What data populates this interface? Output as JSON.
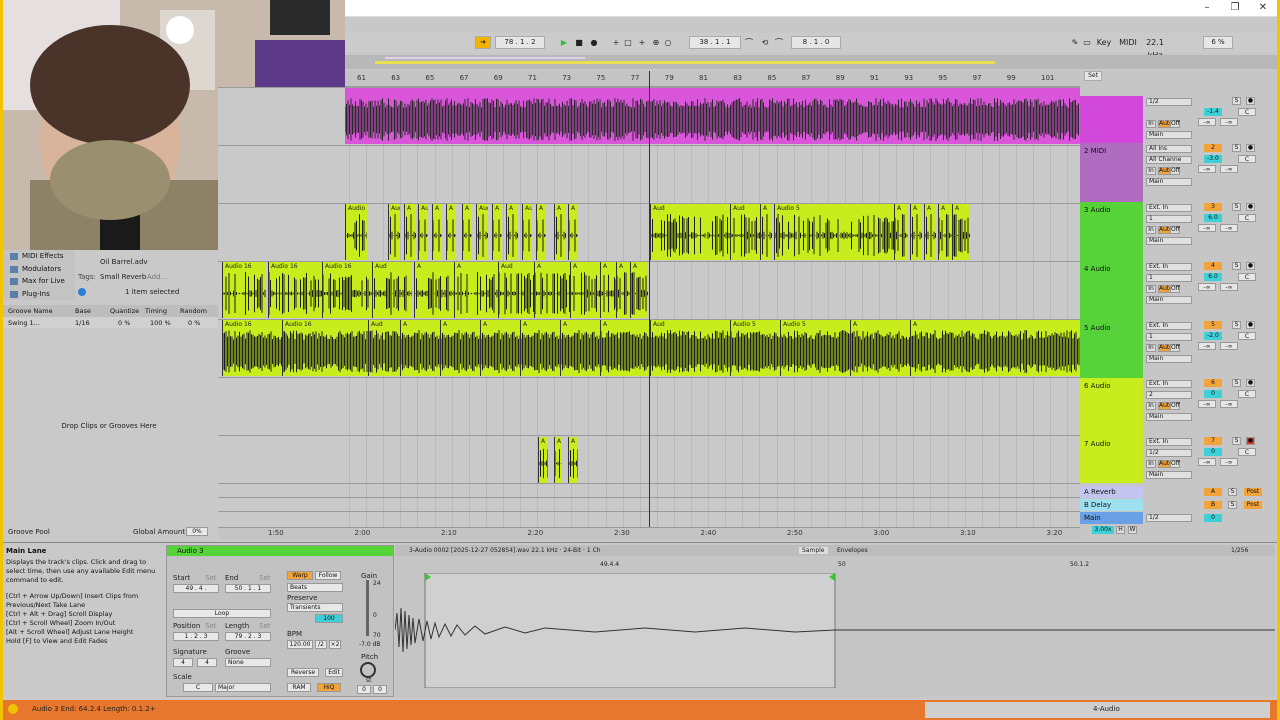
{
  "window": {
    "min": "–",
    "restore": "❐",
    "close": "✕"
  },
  "transport": {
    "follow_icon": "follow-icon",
    "position": "78 .  1 .  2",
    "loop_start": "38 .  1 .  1",
    "loop_length": "8 .  1 .  0",
    "key_label": "Key",
    "midi_label": "MIDI",
    "sample_rate": "22.1 kHz",
    "cpu": "6 %"
  },
  "ruler": {
    "bars": [
      "61",
      "63",
      "65",
      "67",
      "69",
      "71",
      "73",
      "75",
      "77",
      "79",
      "81",
      "83",
      "85",
      "87",
      "89",
      "91",
      "93",
      "95",
      "97",
      "99",
      "101"
    ],
    "times": [
      "1:50",
      "2:00",
      "2:10",
      "2:20",
      "2:30",
      "2:40",
      "2:50",
      "3:00",
      "3:10",
      "3:20"
    ],
    "set_label": "Set"
  },
  "tracks": [
    {
      "name": "",
      "color": "#d147d9",
      "input": "1/2",
      "input2": "",
      "monitor": [
        "In",
        "Auto",
        "Off"
      ],
      "out": "Main",
      "vol": "-1.4",
      "pan": "C",
      "send": "-∞"
    },
    {
      "name": "2 MIDI",
      "color": "#b06cc0",
      "input": "All Ins",
      "input2": "All Channe",
      "monitor": [
        "In",
        "Auto",
        "Off"
      ],
      "out": "Main",
      "vol": "-3.0",
      "pan": "C",
      "num": "2",
      "send": "-∞"
    },
    {
      "name": "3 Audio",
      "color": "#57d33a",
      "input": "Ext. In",
      "input2": "1",
      "monitor": [
        "In",
        "Auto",
        "Off"
      ],
      "out": "Main",
      "vol": "6.0",
      "pan": "C",
      "num": "3",
      "send": "-∞"
    },
    {
      "name": "4 Audio",
      "color": "#57d33a",
      "input": "Ext. In",
      "input2": "1",
      "monitor": [
        "In",
        "Auto",
        "Off"
      ],
      "out": "Main",
      "vol": "6.0",
      "pan": "C",
      "num": "4",
      "send": "-∞"
    },
    {
      "name": "5 Audio",
      "color": "#57d33a",
      "input": "Ext. In",
      "input2": "1",
      "monitor": [
        "In",
        "Auto",
        "Off"
      ],
      "out": "Main",
      "vol": "-2.0",
      "pan": "C",
      "num": "5",
      "send": "-∞"
    },
    {
      "name": "6 Audio",
      "color": "#c8ec1c",
      "input": "Ext. In",
      "input2": "2",
      "monitor": [
        "In",
        "Auto",
        "Off"
      ],
      "out": "Main",
      "vol": "0",
      "pan": "C",
      "num": "6",
      "send": "-∞"
    },
    {
      "name": "7 Audio",
      "color": "#c8ec1c",
      "input": "Ext. In",
      "input2": "1/2",
      "monitor": [
        "In",
        "Auto",
        "Off"
      ],
      "out": "Main",
      "vol": "0",
      "pan": "C",
      "num": "7",
      "send": "-∞"
    }
  ],
  "returns": [
    {
      "name": "A Reverb",
      "num": "A",
      "post": "Post"
    },
    {
      "name": "B Delay",
      "num": "B",
      "post": "Post"
    }
  ],
  "main": {
    "name": "Main",
    "out": "1/2",
    "vol": "0",
    "zoom": "3.00x",
    "h": "H",
    "w": "W"
  },
  "clip_labels": {
    "a16": "Audio 16",
    "a5": "Audio 5",
    "au": "Aud",
    "a": "A"
  },
  "browser": {
    "items": [
      "MIDI Effects",
      "Modulators",
      "Max for Live",
      "Plug-Ins"
    ],
    "file": "Oil Barrel.adv",
    "tags_label": "Tags:",
    "tag": "Small Reverb",
    "add": "Add...",
    "selected": "1 item selected",
    "groove_headers": [
      "Groove Name",
      "Base",
      "Quantize",
      "Timing",
      "Random"
    ],
    "groove_row": [
      "Swing 1...",
      "1/16",
      "0 %",
      "100 %",
      "0 %"
    ],
    "drop_text": "Drop Clips or Grooves Here",
    "groove_pool": "Groove Pool",
    "global_amount_label": "Global Amount",
    "global_amount": "0%"
  },
  "info": {
    "title": "Main Lane",
    "text1": "Displays the track's clips. Click and drag to select time, then use any available Edit menu command to edit.",
    "text2": "[Ctrl + Arrow Up/Down] Insert Clips from Previous/Next Take Lane",
    "text3": "[Ctrl + Alt + Drag] Scroll Display",
    "text4": "[Ctrl + Scroll Wheel] Zoom In/Out",
    "text5": "[Alt + Scroll Wheel] Adjust Lane Height",
    "text6": "Hold [F] to View and Edit Fades"
  },
  "clip_view": {
    "clip_name": "Audio 3",
    "file": "3-Audio 0002 [2025-12-27 052854].wav  22.1 kHz · 24-Bit · 1 Ch",
    "tab_sample": "Sample",
    "tab_env": "Envelopes",
    "page": "1/256",
    "start_label": "Start",
    "end_label": "End",
    "set": "Set",
    "start_val": "49 .  4 .",
    "end_val": "50 .  1 .  1",
    "loop": "Loop",
    "position_label": "Position",
    "length_label": "Length",
    "position_val": "1 .  2 .  3",
    "length_val": "79 .  2 .  3",
    "signature_label": "Signature",
    "groove_label": "Groove",
    "sig_num": "4",
    "sig_den": "4",
    "groove_val": "None",
    "scale_label": "Scale",
    "scale_root": "C",
    "scale_mode": "Major",
    "warp": "Warp",
    "follow": "Follow",
    "beats": "Beats",
    "preserve": "Preserve",
    "transients": "Transients",
    "bpm_label": "BPM",
    "bpm": "120.00",
    "half": "/2",
    "double": "×2",
    "pct": "100",
    "reverse": "Reverse",
    "edit": "Edit",
    "ram": "RAM",
    "hiq": "HiQ",
    "gain_label": "Gain",
    "gain_top": "24",
    "gain_mid": "0",
    "gain_low": "70",
    "gain_val": "-7.0 dB",
    "pitch_label": "Pitch",
    "pitch_st": "st",
    "pitch_a": "0",
    "pitch_b": "0",
    "marker_a": "49.4.4",
    "marker_b": "50",
    "marker_c": "50.1.2"
  },
  "status": {
    "text": "Audio 3  End: 64.2.4  Length: 0.1.2+",
    "track": "4-Audio"
  }
}
